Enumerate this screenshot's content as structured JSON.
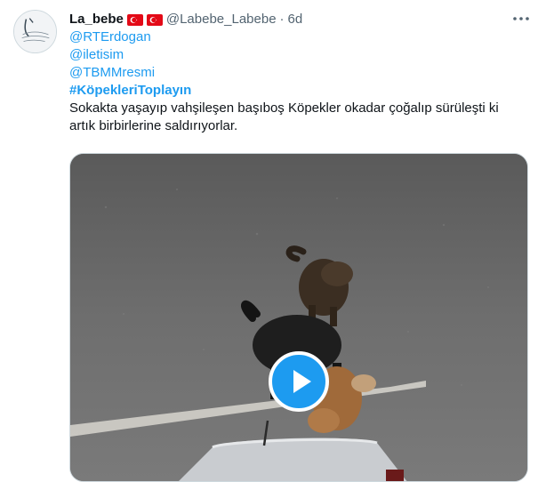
{
  "tweet": {
    "name": "La_bebe",
    "handle": "@Labebe_Labebe",
    "separator": "·",
    "time": "6d",
    "mentions": [
      "@RTErdogan",
      "@iletisim",
      "@TBMMresmi"
    ],
    "hashtag": "#KöpekleriToplayın",
    "text": "Sokakta yaşayıp vahşileşen başıboş Köpekler okadar çoğalıp sürüleşti ki artık birbirlerine saldırıyorlar.",
    "flags": [
      "turkey-flag",
      "turkey-flag"
    ]
  },
  "media": {
    "type": "video",
    "play_icon": "play-icon"
  },
  "colors": {
    "accent": "#1d9bf0",
    "text": "#0f1419",
    "secondary": "#536471"
  }
}
